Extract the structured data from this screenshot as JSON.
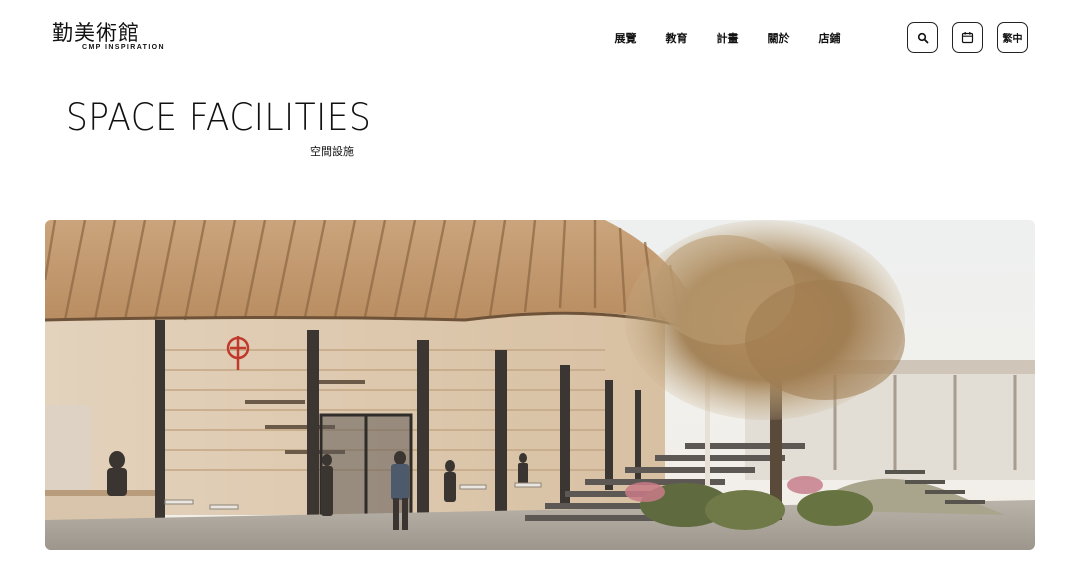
{
  "header": {
    "logo": {
      "name_cn": "勤美術館",
      "name_en": "CMP INSPIRATION"
    },
    "nav": [
      {
        "label": "展覽"
      },
      {
        "label": "教育"
      },
      {
        "label": "計畫"
      },
      {
        "label": "關於"
      },
      {
        "label": "店鋪"
      }
    ],
    "search_icon": "search-icon",
    "calendar_icon": "calendar-icon",
    "language_label": "繁中"
  },
  "main": {
    "title": "SPACE FACILITIES",
    "subtitle": "空間設施",
    "hero_image": "architectural-rendering-museum-entrance"
  },
  "colors": {
    "text": "#111111",
    "background": "#ffffff",
    "wood": "#c9a27a",
    "accent_red": "#c0392b"
  }
}
